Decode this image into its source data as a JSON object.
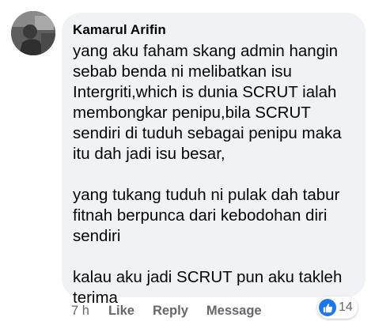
{
  "comment": {
    "author": "Kamarul Arifin",
    "paragraphs": [
      "yang aku faham skang admin hangin sebab benda ni melibatkan isu Intergriti,which is dunia SCRUT ialah membongkar penipu,bila SCRUT sendiri di tuduh sebagai penipu maka itu dah jadi isu besar,",
      "yang tukang tuduh ni pulak dah tabur fitnah berpunca dari kebodohan diri sendiri",
      "kalau aku jadi SCRUT pun aku takleh terima"
    ],
    "time": "7 h",
    "actions": {
      "like": "Like",
      "reply": "Reply",
      "message": "Message"
    },
    "reactions": {
      "icon": "thumbs-up-icon",
      "count": "14",
      "color": "#1877f2"
    }
  },
  "colors": {
    "bubble": "#f0f2f5",
    "text": "#050505",
    "secondary_text": "#65676b"
  }
}
